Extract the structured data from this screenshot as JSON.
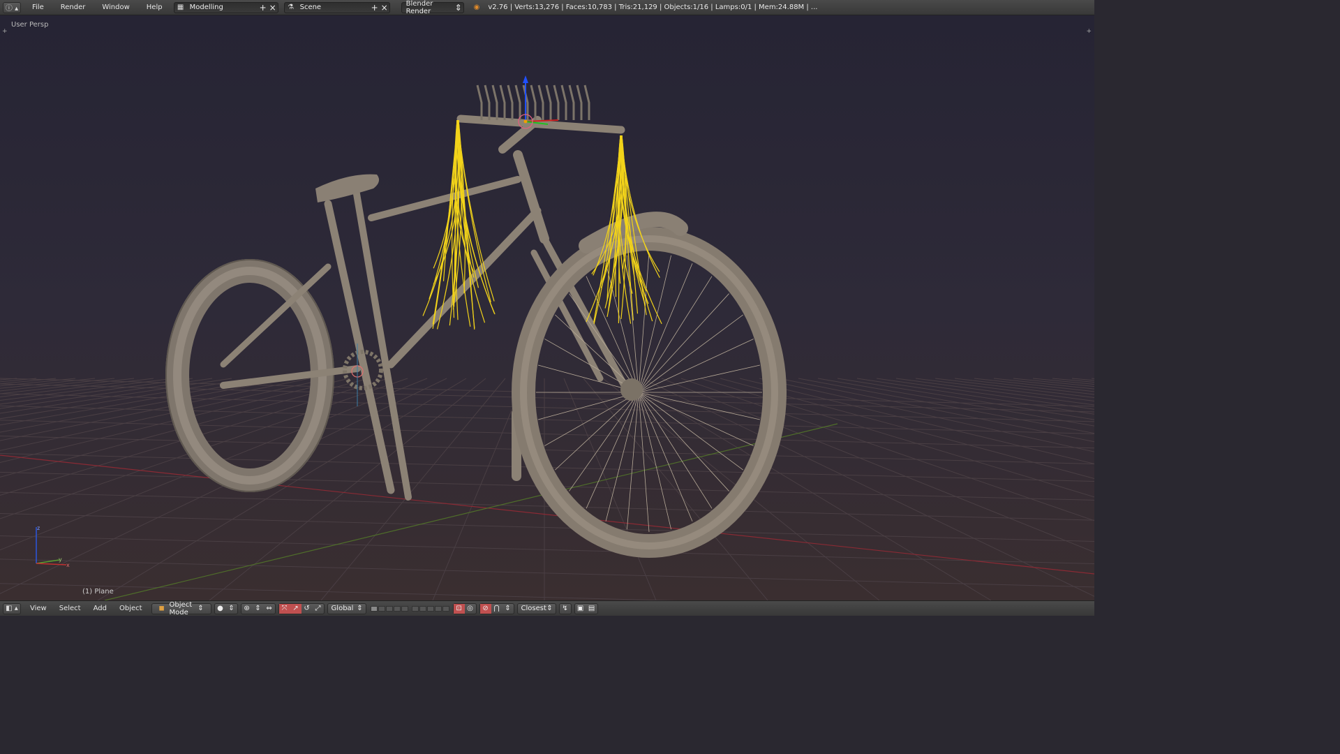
{
  "topbar": {
    "menus": [
      "File",
      "Render",
      "Window",
      "Help"
    ],
    "screen_layout": "Modelling",
    "scene": "Scene",
    "render_engine": "Blender Render",
    "stats": "v2.76 | Verts:13,276 | Faces:10,783 | Tris:21,129 | Objects:1/16 | Lamps:0/1 | Mem:24.88M | ..."
  },
  "viewport": {
    "view_label": "User Persp",
    "object_label": "(1) Plane",
    "axis_labels": {
      "x": "x",
      "y": "y",
      "z": "z"
    },
    "colors": {
      "grid": "#4a3f44",
      "x_axis": "#8a2a34",
      "y_axis": "#4f6e2a",
      "mesh": "#8f8578",
      "hair": "#f2d31a"
    }
  },
  "bottombar": {
    "menus": [
      "View",
      "Select",
      "Add",
      "Object"
    ],
    "mode": "Object Mode",
    "transform_orientation": "Global",
    "snap_target": "Closest"
  }
}
